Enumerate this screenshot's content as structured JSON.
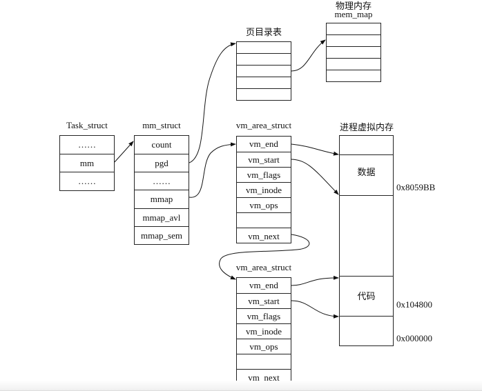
{
  "task_struct": {
    "title": "Task_struct",
    "fields": [
      "……",
      "mm",
      "……"
    ]
  },
  "mm_struct": {
    "title": "mm_struct",
    "fields": [
      "count",
      "pgd",
      "……",
      "mmap",
      "mmap_avl",
      "mmap_sem"
    ]
  },
  "page_directory": {
    "title": "页目录表",
    "rows": 5
  },
  "physical_memory": {
    "title": "物理内存",
    "subtitle": "mem_map",
    "rows": 5
  },
  "vm_area_1": {
    "title": "vm_area_struct",
    "fields": [
      "vm_end",
      "vm_start",
      "vm_flags",
      "vm_inode",
      "vm_ops",
      "",
      "vm_next"
    ]
  },
  "vm_area_2": {
    "title": "vm_area_struct",
    "fields": [
      "vm_end",
      "vm_start",
      "vm_flags",
      "vm_inode",
      "vm_ops",
      "",
      "vm_next"
    ]
  },
  "process_vm": {
    "title": "进程虚拟内存",
    "data_label": "数据",
    "code_label": "代码",
    "addresses": [
      "0x8059BB",
      "0x104800",
      "0x000000"
    ]
  }
}
